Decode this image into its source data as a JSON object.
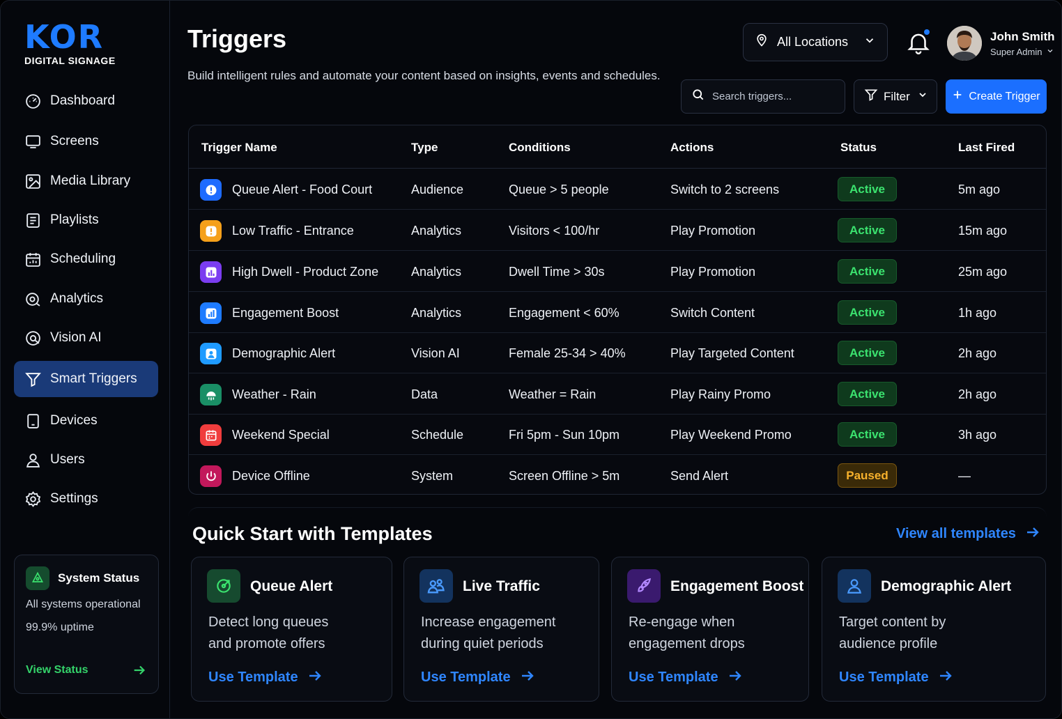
{
  "brand": {
    "name": "KOR",
    "subtitle": "DIGITAL SIGNAGE"
  },
  "sidebar": {
    "items": [
      {
        "label": "Dashboard",
        "icon": "dashboard-icon"
      },
      {
        "label": "Screens",
        "icon": "monitor-icon"
      },
      {
        "label": "Media Library",
        "icon": "media-icon"
      },
      {
        "label": "Playlists",
        "icon": "playlist-icon"
      },
      {
        "label": "Scheduling",
        "icon": "calendar-icon"
      },
      {
        "label": "Analytics",
        "icon": "analytics-icon"
      },
      {
        "label": "Vision AI",
        "icon": "eye-icon"
      },
      {
        "label": "Smart Triggers",
        "icon": "filter-icon",
        "active": true
      },
      {
        "label": "Devices",
        "icon": "device-icon"
      },
      {
        "label": "Users",
        "icon": "user-icon"
      },
      {
        "label": "Settings",
        "icon": "gear-icon"
      }
    ],
    "system_status": {
      "title": "System Status",
      "message": "All systems operational",
      "uptime": "99.9% uptime",
      "link": "View Status"
    }
  },
  "header": {
    "title": "Triggers",
    "subtitle": "Build intelligent rules and automate your content based on insights, events and schedules.",
    "location": "All Locations",
    "user": {
      "name": "John Smith",
      "role": "Super Admin"
    },
    "search_placeholder": "Search triggers...",
    "filter_label": "Filter",
    "create_label": "Create Trigger"
  },
  "table": {
    "columns": [
      "Trigger Name",
      "Type",
      "Conditions",
      "Actions",
      "Status",
      "Last Fired"
    ],
    "rows": [
      {
        "name": "Queue Alert - Food Court",
        "type": "Audience",
        "conditions": "Queue > 5 people",
        "actions": "Switch to 2 screens",
        "status": "Active",
        "last": "5m ago",
        "icon": "alert-icon",
        "color": "#1e6bff"
      },
      {
        "name": "Low Traffic - Entrance",
        "type": "Analytics",
        "conditions": "Visitors < 100/hr",
        "actions": "Play Promotion",
        "status": "Active",
        "last": "15m ago",
        "icon": "alert-icon",
        "color": "#f5a01a"
      },
      {
        "name": "High Dwell - Product Zone",
        "type": "Analytics",
        "conditions": "Dwell Time > 30s",
        "actions": "Play Promotion",
        "status": "Active",
        "last": "25m ago",
        "icon": "chart-icon",
        "color": "#7b3df0"
      },
      {
        "name": "Engagement Boost",
        "type": "Analytics",
        "conditions": "Engagement < 60%",
        "actions": "Switch Content",
        "status": "Active",
        "last": "1h ago",
        "icon": "chart-icon",
        "color": "#1e7bff"
      },
      {
        "name": "Demographic Alert",
        "type": "Vision AI",
        "conditions": "Female 25-34 > 40%",
        "actions": "Play Targeted Content",
        "status": "Active",
        "last": "2h ago",
        "icon": "person-icon",
        "color": "#1f9bff"
      },
      {
        "name": "Weather - Rain",
        "type": "Data",
        "conditions": "Weather = Rain",
        "actions": "Play Rainy Promo",
        "status": "Active",
        "last": "2h ago",
        "icon": "rain-icon",
        "color": "#1a8f66"
      },
      {
        "name": "Weekend Special",
        "type": "Schedule",
        "conditions": "Fri 5pm - Sun 10pm",
        "actions": "Play Weekend Promo",
        "status": "Active",
        "last": "3h ago",
        "icon": "calendar-icon",
        "color": "#f03d3d"
      },
      {
        "name": "Device Offline",
        "type": "System",
        "conditions": "Screen Offline > 5m",
        "actions": "Send Alert",
        "status": "Paused",
        "last": "—",
        "icon": "power-icon",
        "color": "#c2185b"
      }
    ]
  },
  "templates": {
    "title": "Quick Start with Templates",
    "view_all": "View all templates",
    "items": [
      {
        "name": "Queue Alert",
        "desc1": "Detect long queues",
        "desc2": "and promote offers",
        "cta": "Use Template",
        "icon": "target-icon",
        "color": "#164a2f"
      },
      {
        "name": "Live Traffic",
        "desc1": "Increase engagement",
        "desc2": "during quiet periods",
        "cta": "Use Template",
        "icon": "people-icon",
        "color": "#13335e"
      },
      {
        "name": "Engagement Boost",
        "desc1": "Re-engage when",
        "desc2": "engagement drops",
        "cta": "Use Template",
        "icon": "rocket-icon",
        "color": "#3a1a6e"
      },
      {
        "name": "Demographic Alert",
        "desc1": "Target content by",
        "desc2": "audience profile",
        "cta": "Use Template",
        "icon": "person-icon",
        "color": "#13335e"
      }
    ]
  },
  "colors": {
    "accent": "#1b6fff",
    "active": "#3be36f",
    "paused": "#f7b12c"
  }
}
